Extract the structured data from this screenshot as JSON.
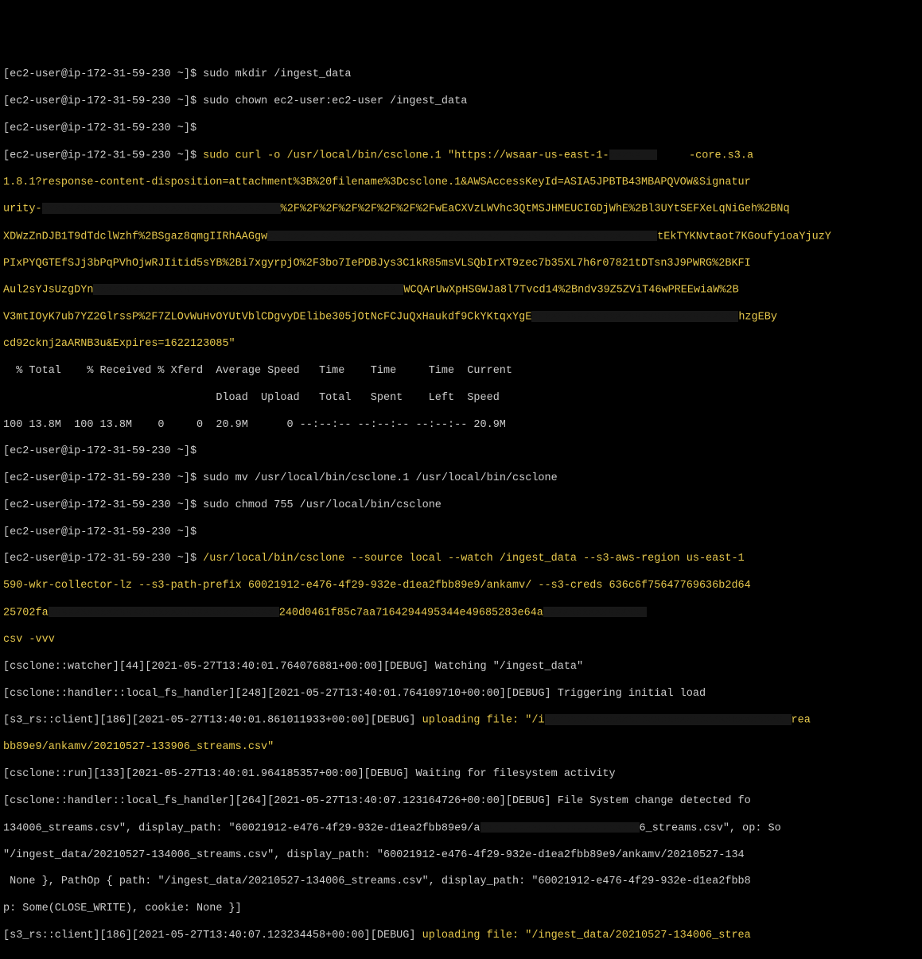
{
  "prompt": "[ec2-user@ip-172-31-59-230 ~]$",
  "cmds": {
    "mkdir": "sudo mkdir /ingest_data",
    "chown": "sudo chown ec2-user:ec2-user /ingest_data",
    "empty": "",
    "curl_pre": "sudo curl -o /usr/local/bin/csclone.1 \"https://wsaar-us-east-1-",
    "curl_post": "-core.s3.a",
    "curl_l2a": "1.8.1?response-content-disposition=attachment%3B%20filename%3Dcsclone.1&AWSAccessKeyId=ASIA5JPBTB43MBAPQVOW&Signatur",
    "curl_l3a": "urity-",
    "curl_l3b": "%2F%2F%2F%2F%2F%2F%2F%2FwEaCXVzLWVhc3QtMSJHMEUCIGDjWhE%2Bl3UYtSEFXeLqNiGeh%2BNq",
    "curl_l4a": "XDWzZnDJB1T9dTdclWzhf%2BSgaz8qmgIIRhAAGgw",
    "curl_l4b": "tEkTYKNvtaot7KGoufy1oaYjuzY",
    "curl_l5": "PIxPYQGTEfSJj3bPqPVhOjwRJIitid5sYB%2Bi7xgyrpjO%2F3bo7IePDBJys3C1kR85msVLSQbIrXT9zec7b35XL7h6r07821tDTsn3J9PWRG%2BKFI",
    "curl_l6a": "Aul2sYJsUzgDYn",
    "curl_l6b": "WCQArUwXpHSGWJa8l7Tvcd14%2Bndv39Z5ZViT46wPREEwiaW%2B",
    "curl_l7a": "V3mtIOyK7ub7YZ2GlrssP%2F7ZLOvWuHvOYUtVblCDgvyDElibe305jOtNcFCJuQxHaukdf9CkYKtqxYgE",
    "curl_l7b": "hzgEBy",
    "curl_l8": "cd92cknj2aARNB3u&Expires=1622123085\"",
    "stats_hdr": "  % Total    % Received % Xferd  Average Speed   Time    Time     Time  Current",
    "stats_hdr2": "                                 Dload  Upload   Total   Spent    Left  Speed",
    "stats_row": "100 13.8M  100 13.8M    0     0  20.9M      0 --:--:-- --:--:-- --:--:-- 20.9M",
    "mv": "sudo mv /usr/local/bin/csclone.1 /usr/local/bin/csclone",
    "chmod": "sudo chmod 755 /usr/local/bin/csclone",
    "run_a": "/usr/local/bin/csclone --source local --watch /ingest_data --s3-aws-region us-east-1",
    "run_b": "590-wkr-collector-lz --s3-path-prefix 60021912-e476-4f29-932e-d1ea2fbb89e9/ankamv/ --s3-creds 636c6f75647769636b2d64",
    "run_c1": "25702fa",
    "run_c2": "240d0461f85c7aa7164294495344e49685283e64a",
    "run_d": "csv -vvv",
    "log1": "[csclone::watcher][44][2021-05-27T13:40:01.764076881+00:00][DEBUG] Watching \"/ingest_data\"",
    "log2": "[csclone::handler::local_fs_handler][248][2021-05-27T13:40:01.764109710+00:00][DEBUG] Triggering initial load",
    "log3a": "[s3_rs::client][186][2021-05-27T13:40:01.861011933+00:00][DEBUG] ",
    "log3b": "uploading file: \"/i",
    "log3c": "rea",
    "log4": "bb89e9/ankamv/20210527-133906_streams.csv\"",
    "log5": "[csclone::run][133][2021-05-27T13:40:01.964185357+00:00][DEBUG] Waiting for filesystem activity",
    "log6": "[csclone::handler::local_fs_handler][264][2021-05-27T13:40:07.123164726+00:00][DEBUG] File System change detected fo",
    "log7a": "134006_streams.csv\", display_path: \"60021912-e476-4f29-932e-d1ea2fbb89e9/a",
    "log7b": "6_streams.csv\", op: So",
    "log8": "\"/ingest_data/20210527-134006_streams.csv\", display_path: \"60021912-e476-4f29-932e-d1ea2fbb89e9/ankamv/20210527-134",
    "log9": " None }, PathOp { path: \"/ingest_data/20210527-134006_streams.csv\", display_path: \"60021912-e476-4f29-932e-d1ea2fbb8",
    "log10": "p: Some(CLOSE_WRITE), cookie: None }]",
    "log11a": "[s3_rs::client][186][2021-05-27T13:40:07.123234458+00:00][DEBUG] ",
    "log11b": "uploading file: \"/ingest_data/20210527-134006_strea"
  }
}
